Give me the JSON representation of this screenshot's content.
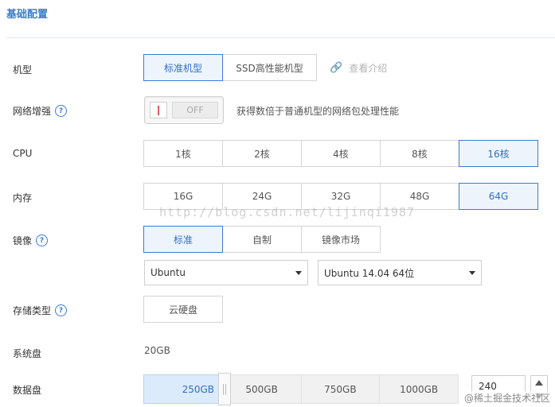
{
  "section": {
    "title": "基础配置"
  },
  "model": {
    "label": "机型",
    "options": [
      "标准机型",
      "SSD高性能机型"
    ],
    "selected": "标准机型",
    "info_link": "查看介绍"
  },
  "network_boost": {
    "label": "网络增强",
    "help": "?",
    "toggle_state": "OFF",
    "description": "获得数倍于普通机型的网络包处理性能"
  },
  "cpu": {
    "label": "CPU",
    "options": [
      "1核",
      "2核",
      "4核",
      "8核",
      "16核"
    ],
    "selected": "16核"
  },
  "memory": {
    "label": "内存",
    "options": [
      "16G",
      "24G",
      "32G",
      "48G",
      "64G"
    ],
    "selected": "64G"
  },
  "image": {
    "label": "镜像",
    "help": "?",
    "tabs": [
      "标准",
      "自制",
      "镜像市场"
    ],
    "selected_tab": "标准",
    "os_select": "Ubuntu",
    "version_select": "Ubuntu 14.04 64位"
  },
  "storage_type": {
    "label": "存储类型",
    "help": "?",
    "option": "云硬盘"
  },
  "system_disk": {
    "label": "系统盘",
    "value": "20GB"
  },
  "data_disk": {
    "label": "数据盘",
    "ticks": [
      "250GB",
      "500GB",
      "750GB",
      "1000GB"
    ],
    "slider_fraction": 0.24,
    "input_value": "240"
  },
  "watermarks": {
    "blog_url": "http://blog.csdn.net/lijinqi1987",
    "site": "@稀土掘金技术社区"
  },
  "colors": {
    "accent": "#3a7bd5",
    "selected_bg": "#eef4fc",
    "slider_fill": "#dcebfb"
  },
  "icons": {
    "link": "link-icon",
    "help": "question-circle-icon",
    "caret": "caret-down-icon"
  }
}
